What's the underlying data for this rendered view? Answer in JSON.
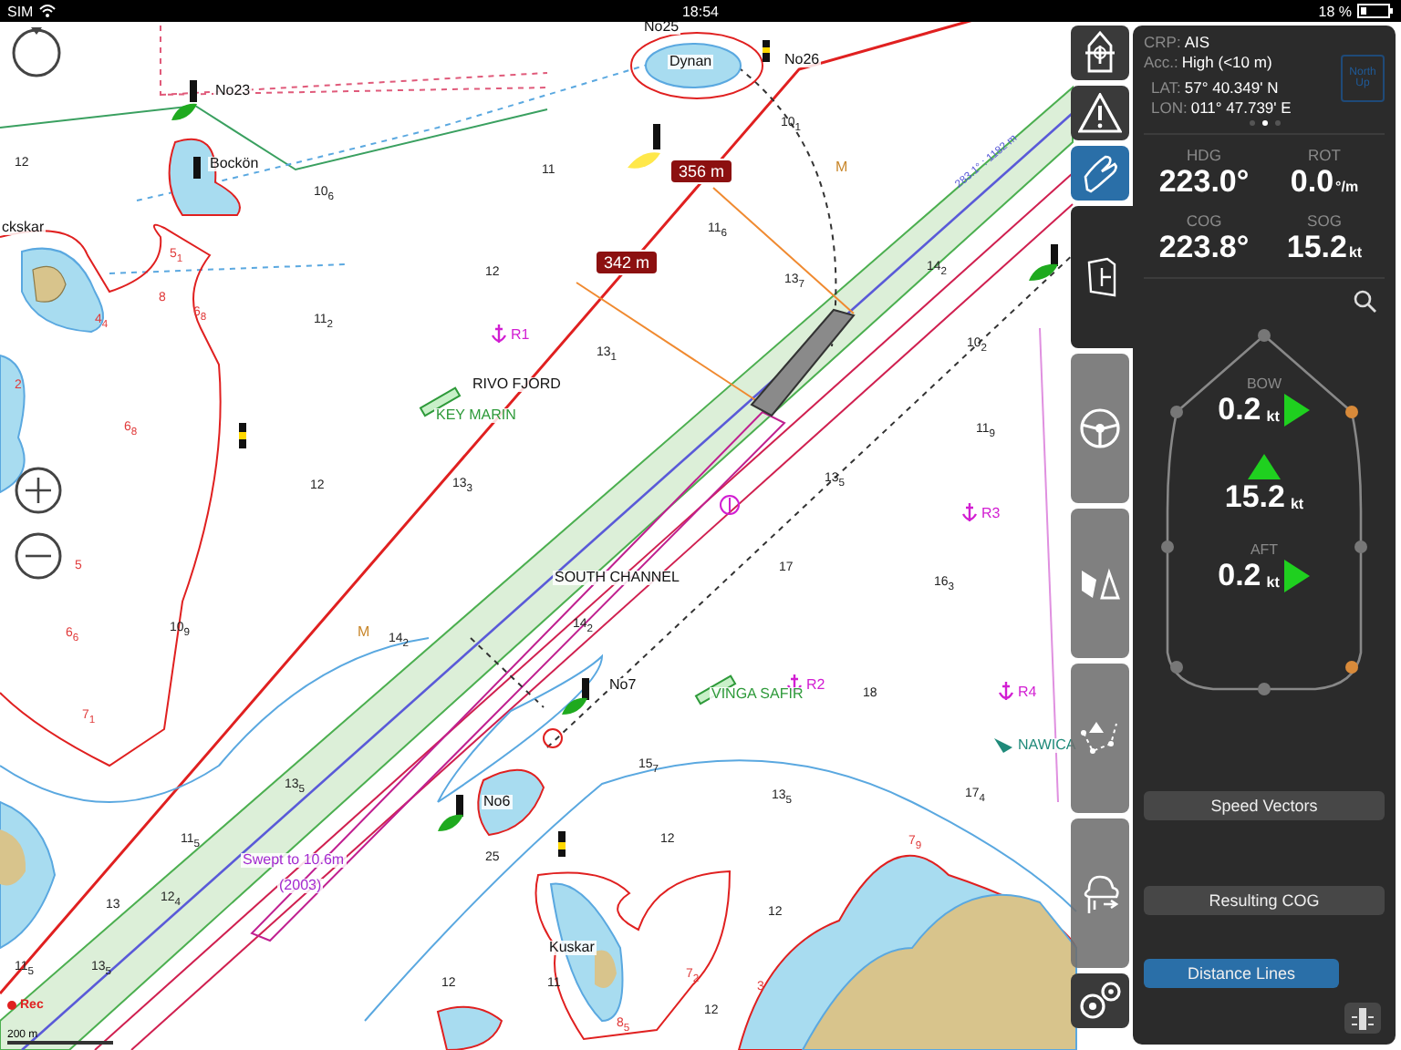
{
  "status_bar": {
    "carrier": "SIM",
    "time": "18:54",
    "battery": "18 %"
  },
  "chart": {
    "labels": [
      {
        "kind": "place",
        "text": "No25"
      },
      {
        "kind": "place",
        "text": "Dynan"
      },
      {
        "kind": "place",
        "text": "No26"
      },
      {
        "kind": "place",
        "text": "No23"
      },
      {
        "kind": "place",
        "text": "Bockön"
      },
      {
        "kind": "place",
        "text": "ckskar"
      },
      {
        "kind": "note",
        "text": "M"
      },
      {
        "kind": "anchorage",
        "text": "R1"
      },
      {
        "kind": "place",
        "text": "RIVO FJORD"
      },
      {
        "kind": "marina",
        "text": "KEY MARIN"
      },
      {
        "kind": "anchorage",
        "text": "R3"
      },
      {
        "kind": "place",
        "text": "SOUTH CHANNEL"
      },
      {
        "kind": "note",
        "text": "M"
      },
      {
        "kind": "place",
        "text": "No7"
      },
      {
        "kind": "anchorage",
        "text": "R2"
      },
      {
        "kind": "marina",
        "text": "VINGA SAFIR"
      },
      {
        "kind": "anchorage",
        "text": "R4"
      },
      {
        "kind": "ship",
        "text": "NAWICA"
      },
      {
        "kind": "place",
        "text": "No6"
      },
      {
        "kind": "route",
        "text": "Swept to 10.6m"
      },
      {
        "kind": "route",
        "text": "(2003)"
      },
      {
        "kind": "place",
        "text": "Kuskar"
      }
    ],
    "soundings": [
      {
        "kind": "deep",
        "text": "12"
      },
      {
        "kind": "deep",
        "text": "10$_{6}$"
      },
      {
        "kind": "deep",
        "text": "11"
      },
      {
        "kind": "deep",
        "text": "10$_{1}$"
      },
      {
        "kind": "deep",
        "text": "12"
      },
      {
        "kind": "deep",
        "text": "11$_{6}$"
      },
      {
        "kind": "deep",
        "text": "13$_{7}$"
      },
      {
        "kind": "deep",
        "text": "14$_{2}$"
      },
      {
        "kind": "deep",
        "text": "11$_{2}$"
      },
      {
        "kind": "deep",
        "text": "13$_{1}$"
      },
      {
        "kind": "deep",
        "text": "10$_{2}$"
      },
      {
        "kind": "deep",
        "text": "11$_{9}$"
      },
      {
        "kind": "deep",
        "text": "12"
      },
      {
        "kind": "deep",
        "text": "13$_{3}$"
      },
      {
        "kind": "deep",
        "text": "13$_{5}$"
      },
      {
        "kind": "deep",
        "text": "17"
      },
      {
        "kind": "deep",
        "text": "16$_{3}$"
      },
      {
        "kind": "deep",
        "text": "10$_{9}$"
      },
      {
        "kind": "deep",
        "text": "14$_{2}$"
      },
      {
        "kind": "deep",
        "text": "14$_{2}$"
      },
      {
        "kind": "deep",
        "text": "18"
      },
      {
        "kind": "deep",
        "text": "15$_{7}$"
      },
      {
        "kind": "deep",
        "text": "13$_{5}$"
      },
      {
        "kind": "deep",
        "text": "17$_{4}$"
      },
      {
        "kind": "deep",
        "text": "13$_{5}$"
      },
      {
        "kind": "deep",
        "text": "11$_{5}$"
      },
      {
        "kind": "deep",
        "text": "25"
      },
      {
        "kind": "deep",
        "text": "12"
      },
      {
        "kind": "deep",
        "text": "12"
      },
      {
        "kind": "deep",
        "text": "12$_{4}$"
      },
      {
        "kind": "deep",
        "text": "13"
      },
      {
        "kind": "deep",
        "text": "12"
      },
      {
        "kind": "deep",
        "text": "11"
      },
      {
        "kind": "deep",
        "text": "12"
      },
      {
        "kind": "deep",
        "text": "11$_{5}$"
      },
      {
        "kind": "deep",
        "text": "13$_{5}$"
      },
      {
        "kind": "shallow",
        "text": "5$_{1}$"
      },
      {
        "kind": "shallow",
        "text": "8"
      },
      {
        "kind": "shallow",
        "text": "6$_{8}$"
      },
      {
        "kind": "shallow",
        "text": "4$_{4}$"
      },
      {
        "kind": "shallow",
        "text": "6$_{8}$"
      },
      {
        "kind": "shallow",
        "text": "5"
      },
      {
        "kind": "shallow",
        "text": "6$_{6}$"
      },
      {
        "kind": "shallow",
        "text": "7$_{1}$"
      },
      {
        "kind": "shallow",
        "text": "7$_{9}$"
      },
      {
        "kind": "shallow",
        "text": "7$_{2}$"
      },
      {
        "kind": "shallow",
        "text": "8$_{5}$"
      },
      {
        "kind": "shallow",
        "text": "2"
      },
      {
        "kind": "shallow",
        "text": "3"
      }
    ],
    "distance_tags": [
      "356 m",
      "342 m"
    ],
    "route_note": "283.1° : 1182 m",
    "recording": "Rec",
    "scale": "200 m"
  },
  "toolbar": [
    {
      "kind": "ship",
      "selected": false
    },
    {
      "kind": "warning",
      "selected": false
    },
    {
      "kind": "hand",
      "selected": true
    },
    {
      "kind": "book",
      "selected": false
    },
    {
      "kind": "wheel",
      "selected": false
    },
    {
      "kind": "sail",
      "selected": false
    },
    {
      "kind": "route",
      "selected": false
    },
    {
      "kind": "weather",
      "selected": false
    },
    {
      "kind": "gears",
      "selected": false
    }
  ],
  "panel": {
    "info": [
      {
        "label": "CRP:",
        "value": "AIS"
      },
      {
        "label": "Acc.:",
        "value": "High (<10 m)"
      }
    ],
    "position": [
      {
        "label": "LAT:",
        "value": "57° 40.349' N"
      },
      {
        "label": "LON:",
        "value": "011° 47.739' E"
      }
    ],
    "north_up": "North Up",
    "pages": [
      {
        "selected": false
      },
      {
        "selected": true
      },
      {
        "selected": false
      }
    ],
    "readouts": [
      {
        "label": "HDG",
        "value": "223.0°"
      },
      {
        "label": "ROT",
        "value": "0.0",
        "unit": "°/m"
      },
      {
        "label": "COG",
        "value": "223.8°"
      },
      {
        "label": "SOG",
        "value": "15.2",
        "unit": "kt"
      }
    ],
    "vectors": {
      "bow_label": "BOW",
      "bow": "0.2",
      "bow_unit": "kt",
      "speed": "15.2",
      "speed_unit": "kt",
      "aft_label": "AFT",
      "aft": "0.2",
      "aft_unit": "kt"
    },
    "buttons": [
      {
        "label": "Speed Vectors",
        "selected": false
      },
      {
        "label": "Resulting COG",
        "selected": false
      },
      {
        "label": "Distance Lines",
        "selected": true
      }
    ]
  }
}
